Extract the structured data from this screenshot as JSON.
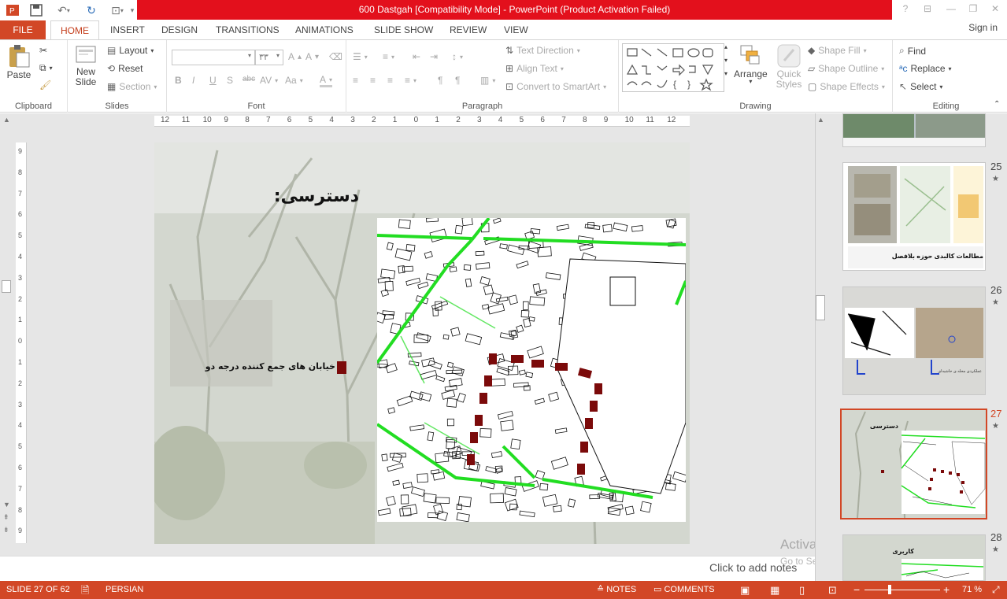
{
  "window": {
    "title": "600 Dastgah [Compatibility Mode] -  PowerPoint (Product Activation Failed)",
    "help": "?",
    "minimize": "—",
    "restore": "❐",
    "close": "✕"
  },
  "tabs": {
    "file": "FILE",
    "items": [
      "HOME",
      "INSERT",
      "DESIGN",
      "TRANSITIONS",
      "ANIMATIONS",
      "SLIDE SHOW",
      "REVIEW",
      "VIEW"
    ],
    "signin": "Sign in"
  },
  "ribbon": {
    "clipboard": {
      "label": "Clipboard",
      "paste": "Paste"
    },
    "slides": {
      "label": "Slides",
      "new_slide": "New Slide",
      "layout": "Layout",
      "reset": "Reset",
      "section": "Section"
    },
    "font": {
      "label": "Font",
      "size": "۳۳",
      "bold": "B",
      "italic": "I",
      "underline": "U",
      "shadow": "S",
      "strike": "abc",
      "spacing": "AV",
      "case": "Aa",
      "color": "A"
    },
    "paragraph": {
      "label": "Paragraph",
      "text_direction": "Text Direction",
      "align_text": "Align Text",
      "smartart": "Convert to SmartArt"
    },
    "drawing": {
      "label": "Drawing",
      "arrange": "Arrange",
      "quick_styles": "Quick Styles",
      "shape_fill": "Shape Fill",
      "shape_outline": "Shape Outline",
      "shape_effects": "Shape Effects"
    },
    "editing": {
      "label": "Editing",
      "find": "Find",
      "replace": "Replace",
      "select": "Select"
    }
  },
  "ruler": {
    "ticks": [
      "12",
      "11",
      "10",
      "9",
      "8",
      "7",
      "6",
      "5",
      "4",
      "3",
      "2",
      "1",
      "0",
      "1",
      "2",
      "3",
      "4",
      "5",
      "6",
      "7",
      "8",
      "9",
      "10",
      "11",
      "12"
    ],
    "vticks": [
      "9",
      "8",
      "7",
      "6",
      "5",
      "4",
      "3",
      "2",
      "1",
      "0",
      "1",
      "2",
      "3",
      "4",
      "5",
      "6",
      "7",
      "8",
      "9"
    ]
  },
  "slide": {
    "title": "دسترسی:",
    "legend_text": "خیابان های جمع کننده درجه دو"
  },
  "notes": {
    "placeholder": "Click to add notes"
  },
  "watermark": {
    "line1": "Activate Windows",
    "line2": "Go to Settings to activate Windows."
  },
  "thumbnails": [
    {
      "num": "25",
      "caption": "مطالعات کالبدی حوزه بلافصل"
    },
    {
      "num": "26",
      "caption": "عملکردی محله ی حاشیه‌ای"
    },
    {
      "num": "27",
      "caption": "دسترسی"
    },
    {
      "num": "28",
      "caption": "کاربری"
    }
  ],
  "status": {
    "slide": "SLIDE 27 OF 62",
    "language": "PERSIAN",
    "notes": "NOTES",
    "comments": "COMMENTS",
    "zoom": "71 %"
  },
  "colors": {
    "accent": "#d24726",
    "titlebar": "#e3101c",
    "road": "#22dd22",
    "marker": "#7b0a0a"
  }
}
